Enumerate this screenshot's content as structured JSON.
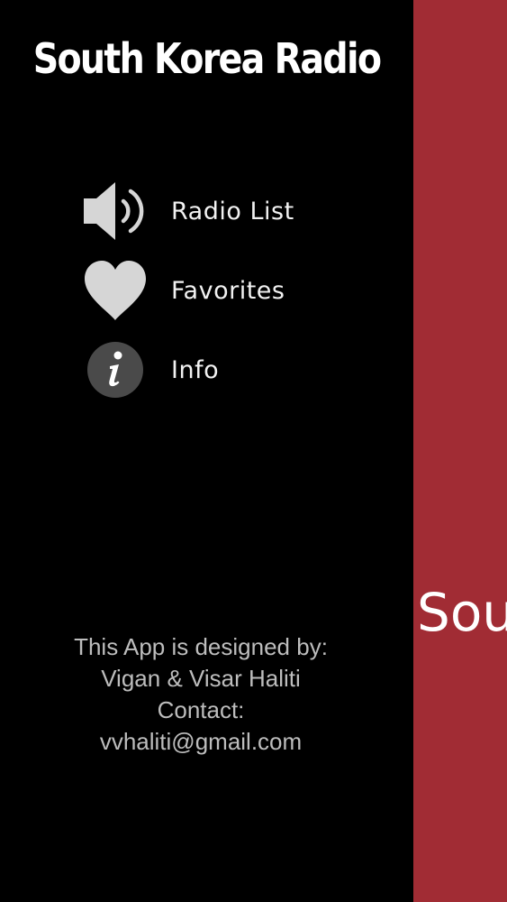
{
  "drawer": {
    "title": "South Korea Radio",
    "menu": [
      {
        "label": "Radio List",
        "icon": "speaker-icon"
      },
      {
        "label": "Favorites",
        "icon": "heart-icon"
      },
      {
        "label": "Info",
        "icon": "info-icon"
      }
    ],
    "credits": {
      "line1": "This App is designed by:",
      "line2": "Vigan & Visar Haliti",
      "line3": "Contact:",
      "line4": "vvhaliti@gmail.com"
    }
  },
  "main": {
    "title_partial": "Sou"
  },
  "colors": {
    "drawer_background": "#000000",
    "main_background": "#a12c34",
    "icon": "#d6d6d6",
    "info_circle": "#4a4a4a",
    "credits_text": "#bdbdbd"
  }
}
